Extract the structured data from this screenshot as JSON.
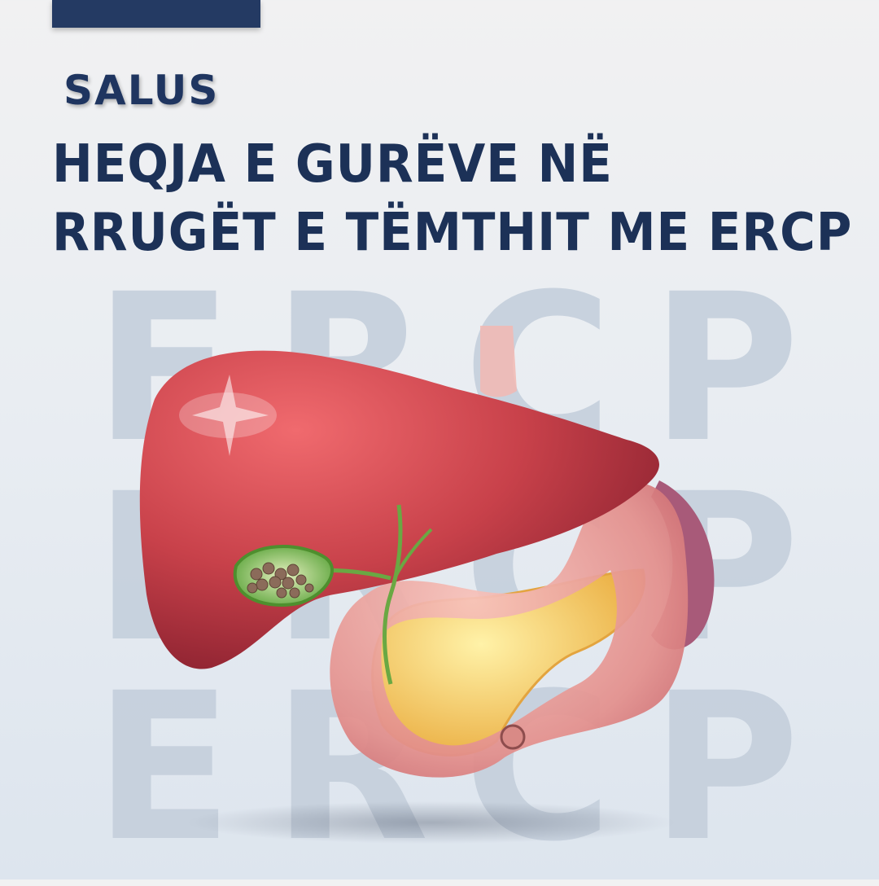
{
  "brand": "SALUS",
  "headline": {
    "line1": "HEQJA E GURËVE NË",
    "line2": "RRUGËT E TËMTHIT ME ERCP"
  },
  "watermark": {
    "rows": [
      [
        "E",
        "R",
        "C",
        "P"
      ],
      [
        "E",
        "R",
        "C",
        "P"
      ],
      [
        "E",
        "R",
        "C",
        "P"
      ]
    ]
  },
  "illustration": {
    "icon": "liver-gallbladder-stomach-pancreas-illustration"
  },
  "colors": {
    "navy": "#1c3157",
    "liver": "#c8414a",
    "gallbladder": "#5aa33a",
    "stomach": "#e79a96",
    "pancreas": "#f2c44f",
    "spleen": "#b05a7a"
  }
}
